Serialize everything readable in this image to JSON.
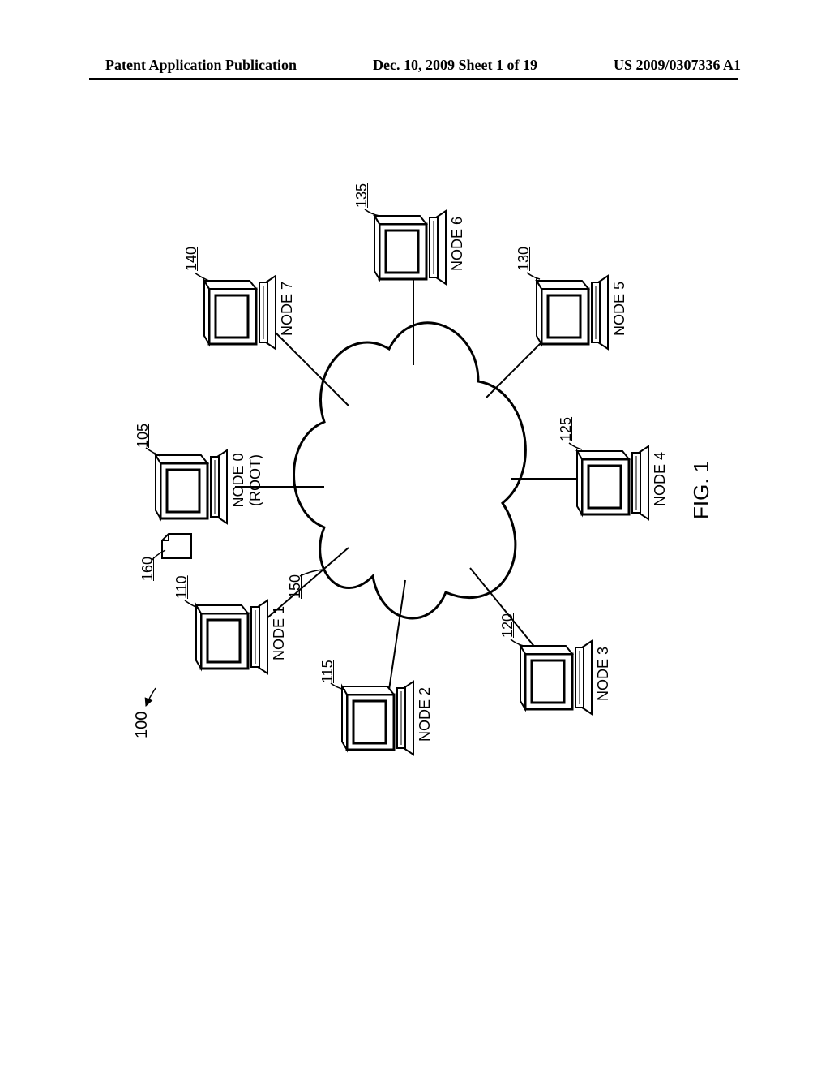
{
  "header": {
    "left": "Patent Application Publication",
    "center": "Dec. 10, 2009  Sheet 1 of 19",
    "right": "US 2009/0307336 A1"
  },
  "figure": {
    "label": "FIG. 1",
    "overall_ref": "100",
    "cloud_ref": "150",
    "doc_ref": "160",
    "nodes": [
      {
        "id": "node0",
        "title_line1": "NODE 0",
        "title_line2": "(ROOT)",
        "ref": "105"
      },
      {
        "id": "node1",
        "title": "NODE 1",
        "ref": "110"
      },
      {
        "id": "node2",
        "title": "NODE 2",
        "ref": "115"
      },
      {
        "id": "node3",
        "title": "NODE 3",
        "ref": "120"
      },
      {
        "id": "node4",
        "title": "NODE 4",
        "ref": "125"
      },
      {
        "id": "node5",
        "title": "NODE 5",
        "ref": "130"
      },
      {
        "id": "node6",
        "title": "NODE 6",
        "ref": "135"
      },
      {
        "id": "node7",
        "title": "NODE 7",
        "ref": "140"
      }
    ]
  }
}
